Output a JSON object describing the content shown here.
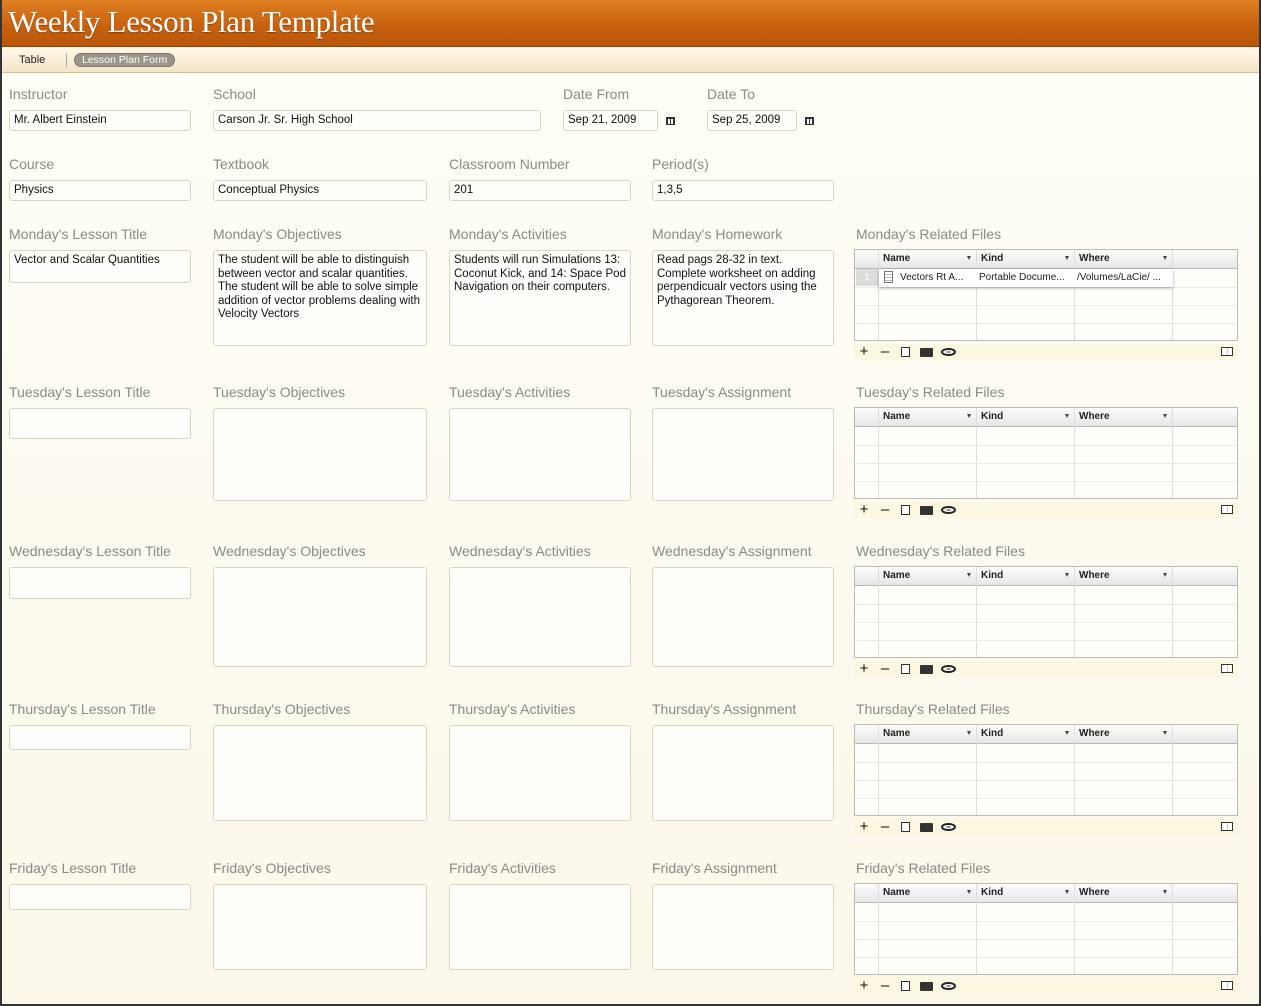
{
  "app": {
    "title": "Weekly Lesson Plan Template"
  },
  "tabs": [
    {
      "label": "Table"
    },
    {
      "label": "Lesson Plan Form"
    }
  ],
  "header_fields": {
    "instructor": {
      "label": "Instructor",
      "value": "Mr. Albert Einstein"
    },
    "school": {
      "label": "School",
      "value": "Carson Jr. Sr. High School"
    },
    "date_from": {
      "label": "Date From",
      "value": "Sep 21, 2009"
    },
    "date_to": {
      "label": "Date To",
      "value": "Sep 25, 2009"
    },
    "course": {
      "label": "Course",
      "value": "Physics"
    },
    "textbook": {
      "label": "Textbook",
      "value": "Conceptual Physics"
    },
    "classroom": {
      "label": "Classroom Number",
      "value": "201"
    },
    "periods": {
      "label": "Period(s)",
      "value": "1,3,5"
    }
  },
  "files_columns": [
    "Name",
    "Kind",
    "Where"
  ],
  "days": [
    {
      "title_label": "Monday's Lesson Title",
      "title_value": "Vector and Scalar Quantities",
      "objectives_label": "Monday's Objectives",
      "objectives_value": "The student will be able to distinguish between vector and scalar quantities. The student will be able to solve simple addition of vector problems dealing with Velocity Vectors",
      "activities_label": "Monday's Activities",
      "activities_value": "Students will run Simulations 13: Coconut Kick, and 14: Space Pod Navigation on their computers.",
      "homework_label": "Monday's Homework",
      "homework_value": "Read pags 28-32 in text. Complete worksheet on adding perpendicualr vectors using the Pythagorean Theorem.",
      "files_label": "Monday's Related Files",
      "files": [
        {
          "row": "1",
          "name": "Vectors Rt A...",
          "kind": "Portable Docume...",
          "where": "/Volumes/LaCie/ ..."
        }
      ]
    },
    {
      "title_label": "Tuesday's Lesson Title",
      "title_value": "",
      "objectives_label": "Tuesday's Objectives",
      "objectives_value": "",
      "activities_label": "Tuesday's Activities",
      "activities_value": "",
      "homework_label": "Tuesday's Assignment",
      "homework_value": "",
      "files_label": "Tuesday's Related Files",
      "files": []
    },
    {
      "title_label": "Wednesday's Lesson Title",
      "title_value": "",
      "objectives_label": "Wednesday's Objectives",
      "objectives_value": "",
      "activities_label": "Wednesday's Activities",
      "activities_value": "",
      "homework_label": "Wednesday's Assignment",
      "homework_value": "",
      "files_label": "Wednesday's Related Files",
      "files": []
    },
    {
      "title_label": "Thursday's Lesson Title",
      "title_value": "",
      "objectives_label": "Thursday's Objectives",
      "objectives_value": "",
      "activities_label": "Thursday's Activities",
      "activities_value": "",
      "homework_label": "Thursday's Assignment",
      "homework_value": "",
      "files_label": "Thursday's Related Files",
      "files": []
    },
    {
      "title_label": "Friday's Lesson Title",
      "title_value": "",
      "objectives_label": "Friday's Objectives",
      "objectives_value": "",
      "activities_label": "Friday's Activities",
      "activities_value": "",
      "homework_label": "Friday's Assignment",
      "homework_value": "",
      "files_label": "Friday's Related Files",
      "files": []
    }
  ],
  "file_toolbar_icons": [
    "plus-icon",
    "minus-icon",
    "import-icon",
    "folder-icon",
    "eye-icon",
    "layout-icon"
  ]
}
